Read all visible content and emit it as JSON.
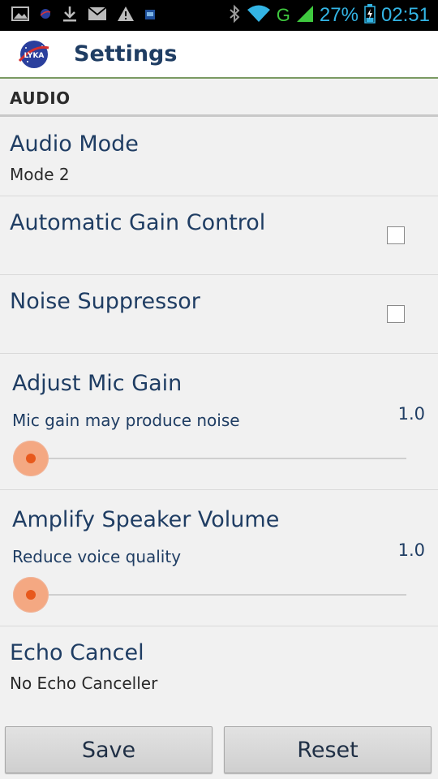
{
  "status_bar": {
    "icons_left": [
      "image-icon",
      "nasa-notification-icon",
      "download-icon",
      "mail-icon",
      "warning-icon",
      "app-notification-icon"
    ],
    "icons_right": [
      "bluetooth-icon",
      "wifi-icon",
      "signal-icon",
      "battery-icon"
    ],
    "network_type": "G",
    "battery_percent": "27%",
    "time": "02:51",
    "battery_level": 0.27
  },
  "action_bar": {
    "logo_icon": "lyka-logo-icon",
    "logo_text": "LYKA",
    "title": "Settings"
  },
  "category": {
    "title": "AUDIO"
  },
  "prefs": {
    "audio_mode": {
      "title": "Audio Mode",
      "summary": "Mode 2"
    },
    "agc": {
      "title": "Automatic Gain Control",
      "checked": false
    },
    "noise": {
      "title": "Noise Suppressor",
      "checked": false
    },
    "mic_gain": {
      "title": "Adjust Mic Gain",
      "summary": "Mic gain may produce noise",
      "value": "1.0",
      "slider_fraction": 0.0
    },
    "speaker": {
      "title": "Amplify Speaker Volume",
      "summary": "Reduce voice quality",
      "value": "1.0",
      "slider_fraction": 0.0
    },
    "echo": {
      "title": "Echo Cancel",
      "summary": "No Echo Canceller"
    }
  },
  "buttons": {
    "save": "Save",
    "reset": "Reset"
  },
  "colors": {
    "accent": "#33b5e5",
    "title_text": "#1f3d63",
    "slider_thumb": "#e8591c",
    "header_divider": "#7a9a63"
  }
}
